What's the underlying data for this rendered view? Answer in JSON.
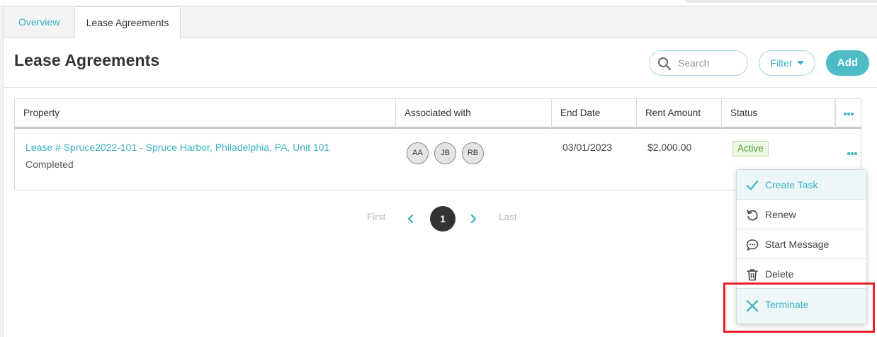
{
  "tabs": [
    {
      "label": "Overview",
      "active": false
    },
    {
      "label": "Lease Agreements",
      "active": true
    }
  ],
  "page": {
    "title": "Lease Agreements"
  },
  "toolbar": {
    "search_placeholder": "Search",
    "filter_label": "Filter",
    "add_label": "Add"
  },
  "table": {
    "columns": [
      "Property",
      "Associated with",
      "End Date",
      "Rent Amount",
      "Status"
    ],
    "rows": [
      {
        "property": "Lease # Spruce2022-101 - Spruce Harbor, Philadelphia, PA, Unit 101",
        "sub": "Completed",
        "associated": [
          "AA",
          "JB",
          "RB"
        ],
        "end_date": "03/01/2023",
        "rent": "$2,000.00",
        "status": "Active"
      }
    ]
  },
  "pagination": {
    "first": "First",
    "current": "1",
    "last": "Last"
  },
  "row_menu": {
    "items": [
      {
        "label": "Create Task",
        "icon": "check-icon"
      },
      {
        "label": "Renew",
        "icon": "renew-icon"
      },
      {
        "label": "Start Message",
        "icon": "message-icon"
      },
      {
        "label": "Delete",
        "icon": "trash-icon"
      },
      {
        "label": "Terminate",
        "icon": "close-icon"
      }
    ]
  },
  "colors": {
    "accent": "#3bb1bf",
    "add_button": "#4dbcc7",
    "status_active": "#4e9b2e",
    "highlight_box": "#e8202a"
  }
}
